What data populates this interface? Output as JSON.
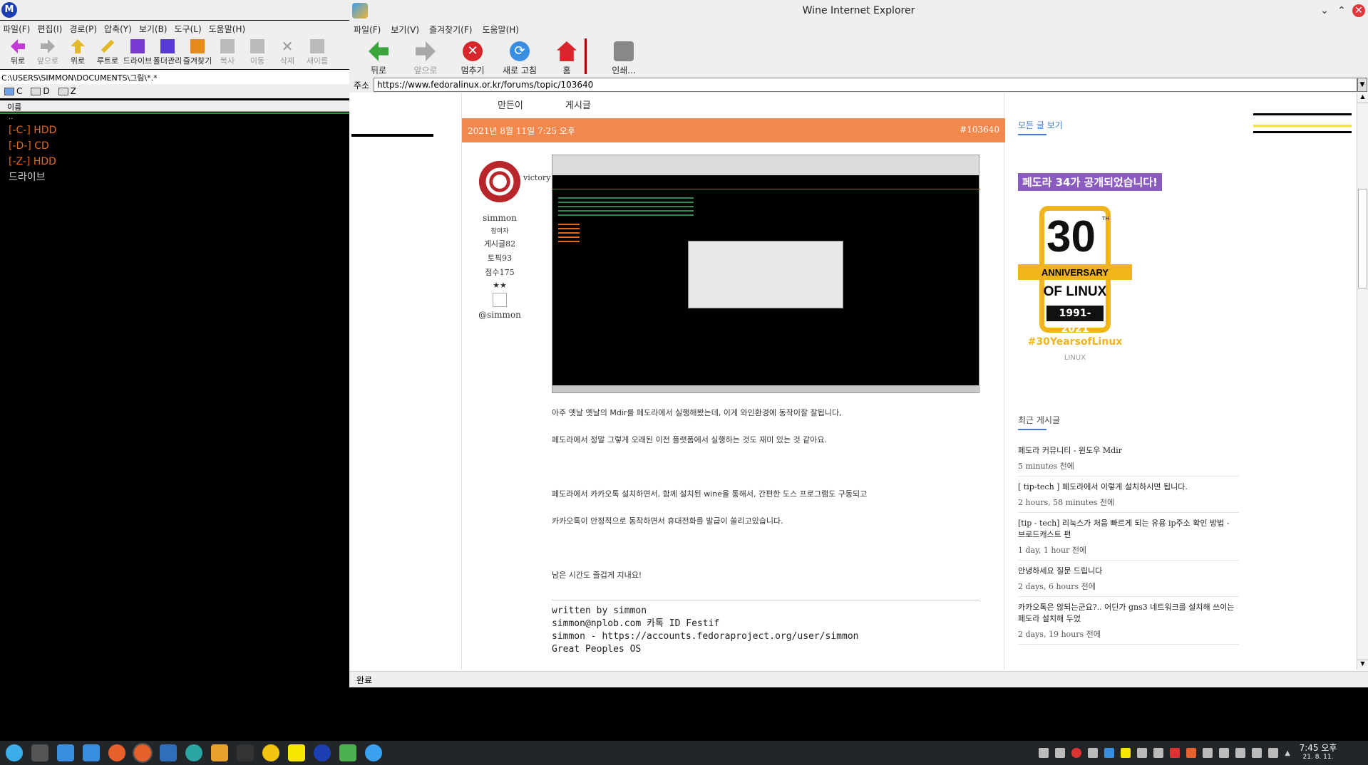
{
  "file_manager": {
    "logo": "M",
    "menu": [
      "파일(F)",
      "편집(I)",
      "경로(P)",
      "압축(Y)",
      "보기(B)",
      "도구(L)",
      "도움말(H)"
    ],
    "toolbar": [
      {
        "label": "뒤로",
        "icon": "back-arrow-icon",
        "enabled": true
      },
      {
        "label": "앞으로",
        "icon": "forward-arrow-icon",
        "enabled": false
      },
      {
        "label": "위로",
        "icon": "up-folder-icon",
        "enabled": true
      },
      {
        "label": "루트로",
        "icon": "root-icon",
        "enabled": true
      },
      {
        "label": "드라이브",
        "icon": "drive-icon",
        "enabled": true
      },
      {
        "label": "폴더관리",
        "icon": "folder-manage-icon",
        "enabled": true
      },
      {
        "label": "즐겨찾기",
        "icon": "favorites-icon",
        "enabled": true
      },
      {
        "label": "복사",
        "icon": "copy-icon",
        "enabled": false
      },
      {
        "label": "이동",
        "icon": "move-icon",
        "enabled": false
      },
      {
        "label": "삭제",
        "icon": "delete-icon",
        "enabled": false
      },
      {
        "label": "새이름",
        "icon": "rename-icon",
        "enabled": false
      }
    ],
    "path": "C:\\USERS\\SIMMON\\DOCUMENTS\\그림\\*.*",
    "drives": [
      "C",
      "D",
      "Z"
    ],
    "column_header": "이름",
    "parent": "..",
    "items": [
      {
        "label": "[-C-] HDD",
        "color": "#e06a1a"
      },
      {
        "label": "[-D-] CD",
        "color": "#e06a1a"
      },
      {
        "label": "[-Z-] HDD",
        "color": "#e06a1a"
      },
      {
        "label": "드라이브",
        "color": "#cfcfcf"
      }
    ]
  },
  "ie": {
    "title": "Wine Internet Explorer",
    "menu": [
      "파일(F)",
      "보기(V)",
      "즐겨찾기(F)",
      "도움말(H)"
    ],
    "toolbar": [
      {
        "label": "뒤로",
        "icon": "back-icon",
        "color": "#3aa53a",
        "enabled": true
      },
      {
        "label": "앞으로",
        "icon": "forward-icon",
        "color": "#a9a9a9",
        "enabled": false
      },
      {
        "label": "멈추기",
        "icon": "stop-icon",
        "color": "#d8262c",
        "enabled": true
      },
      {
        "label": "새로 고침",
        "icon": "refresh-icon",
        "color": "#3a8ee0",
        "enabled": true
      },
      {
        "label": "홈",
        "icon": "home-icon",
        "color": "#d8262c",
        "enabled": true
      },
      {
        "label": "인쇄...",
        "icon": "print-icon",
        "color": "#888888",
        "enabled": true
      }
    ],
    "address_label": "주소",
    "url": "https://www.fedoralinux.or.kr/forums/topic/103640",
    "status": "완료"
  },
  "page": {
    "tabs": [
      "만든이",
      "게시글"
    ],
    "post_date": "2021년 8월 11일 7:25 오후",
    "post_id": "#103640",
    "author": {
      "badge": "victory",
      "name": "simmon",
      "rank": "참여자",
      "posts": "게시글82",
      "topics": "토픽93",
      "score": "점수175",
      "stars": "★★",
      "handle": "@simmon"
    },
    "body": [
      "아주 옛날 옛날의 Mdir를 페도라에서 실행해봤는데, 이게 와인환경에 동작이잘 잘됩니다,",
      "페도라에서 정말 그렇게 오래된 이전 플랫폼에서 실행하는 것도 재미 있는 것 같아요.",
      "페도라에서 카카오톡 설치하면서, 함께 설치된 wine을 통해서, 간편한 도스 프로그램도 구동되고",
      "카카오톡이 안정적으로 동작하면서 휴대전화를 발급이 쏠리고있습니다.",
      "남은 시간도 즐겁게 지내요!"
    ],
    "signature": [
      "written by simmon",
      "simmon@nplob.com 카톡 ID Festif",
      "simmon - https://accounts.fedoraproject.org/user/simmon",
      "Great Peoples OS"
    ]
  },
  "sidebar": {
    "heading1": "모든 글 보기",
    "fedora_badge": "페도라 34가 공개되었습니다!",
    "anniv": {
      "big": "30",
      "th": "TH",
      "line1": "ANNIVERSARY",
      "line2": "OF LINUX",
      "years": "1991-2021",
      "hashtag": "#30YearsofLinux",
      "foundation": "LINUX"
    },
    "heading2": "최근 게시글",
    "recent": [
      {
        "title": "페도라 커뮤니티 - 윈도우 Mdir",
        "time": "5 minutes 전에"
      },
      {
        "title": "[ tip-tech ] 페도라에서 이렇게 설치하시면 됩니다.",
        "time": "2 hours, 58 minutes 전에"
      },
      {
        "title": "[tip - tech] 리눅스가 처음 빠르게 되는 유용 ip주소 확인 방법 - 브로드캐스트 편",
        "time": "1 day, 1 hour 전에"
      },
      {
        "title": "안녕하세요 질문 드립니다",
        "time": "2 days, 6 hours 전에"
      },
      {
        "title": "카카오톡은 않되는군요?.. 어딘가 gns3 네트워크를 설치해 쓰이는 페도라 설치해 두었",
        "time": "2 days, 19 hours 전에"
      }
    ]
  },
  "taskbar": {
    "clock_time": "7:45 오후",
    "clock_date": "21. 8. 11."
  }
}
